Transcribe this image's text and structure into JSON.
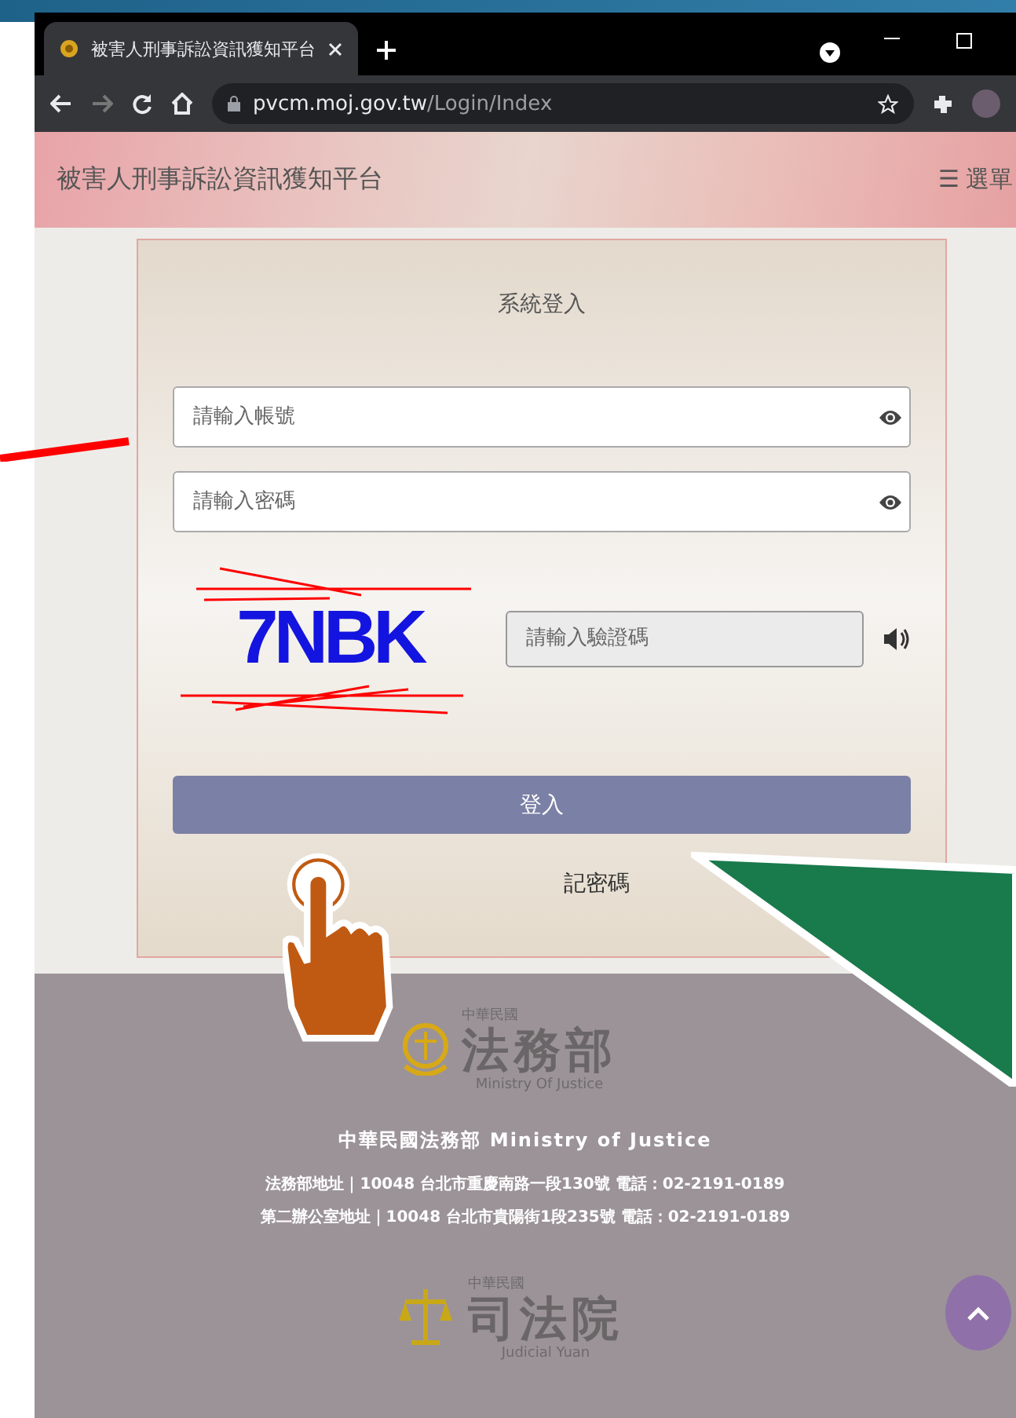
{
  "browser": {
    "tab_title": "被害人刑事訴訟資訊獲知平台",
    "url_host": "pvcm.moj.gov.tw",
    "url_path": "/Login/Index"
  },
  "header": {
    "title": "被害人刑事訴訟資訊獲知平台",
    "menu_icon": "☰",
    "menu": "選單"
  },
  "login": {
    "title": "系統登入",
    "fields": [
      {
        "placeholder": "請輸入帳號"
      },
      {
        "placeholder": "請輸入密碼"
      }
    ],
    "captcha": {
      "code": "7NBK",
      "placeholder": "請輸入驗證碼"
    },
    "submit": "登入",
    "forgot": "記密碼"
  },
  "footer": {
    "logos": [
      {
        "small": "中華民國",
        "name": "法務部",
        "english": "Ministry Of Justice"
      }
    ],
    "org": "中華民國法務部 Ministry of Justice",
    "addresses": [
      "法務部地址｜10048 台北市重慶南路一段130號 電話：02-2191-0189",
      "第二辦公室地址｜10048 台北市貴陽街1段235號 電話：02-2191-0189"
    ],
    "logo2": {
      "small": "中華民國",
      "name": "司法院",
      "english": "Judicial Yuan"
    }
  }
}
